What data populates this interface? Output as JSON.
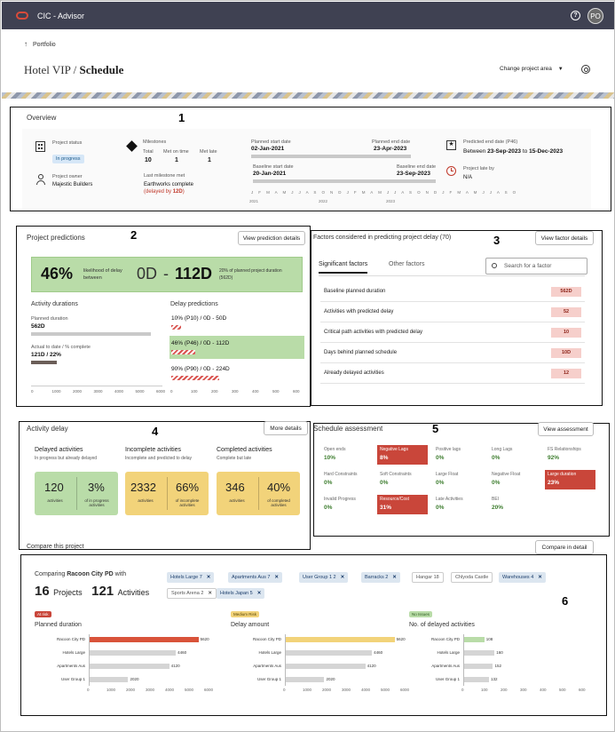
{
  "app": {
    "title": "CIC - Advisor",
    "help": "?",
    "avatar": "PO"
  },
  "breadcrumb": "Portfolio",
  "page": {
    "project": "Hotel VIP",
    "section": "Schedule",
    "change_area": "Change project area"
  },
  "markers": [
    "1",
    "2",
    "3",
    "4",
    "5",
    "6"
  ],
  "overview": {
    "title": "Overview",
    "project_status_label": "Project status",
    "project_status": "In progress",
    "owner_label": "Project owner",
    "owner": "Majestic Builders",
    "milestones_label": "Milestones",
    "ms_total_label": "Total",
    "ms_total": "10",
    "ms_ontime_label": "Met on time",
    "ms_ontime": "1",
    "ms_late_label": "Met late",
    "ms_late": "1",
    "last_ms_label": "Last milestone met",
    "last_ms": "Earthworks complete",
    "last_ms_delay_prefix": "(delayed by ",
    "last_ms_delay": "12D",
    "last_ms_delay_suffix": ")",
    "planned_start_label": "Planned start date",
    "planned_start": "02-Jan-2021",
    "planned_end_label": "Planned end date",
    "planned_end": "23-Apr-2023",
    "baseline_start_label": "Baseline start date",
    "baseline_start": "20-Jan-2021",
    "baseline_end_label": "Baseline end date",
    "baseline_end": "23-Sep-2023",
    "months": "J F M A M J J A S O N D J F M A M J J A S O N D J F M A M J J A S O",
    "years": [
      "2021",
      "2022",
      "2023"
    ],
    "predicted_end_label": "Predicted end date (P46)",
    "predicted_end_prefix": "Between",
    "predicted_end_from": "23-Sep-2023",
    "predicted_end_to_word": "to",
    "predicted_end_to": "15-Dec-2023",
    "late_by_label": "Project late by",
    "late_by": "N/A"
  },
  "predictions": {
    "title": "Project predictions",
    "details_button": "View prediction details",
    "likelihood": "46%",
    "likelihood_text": "likelihood of delay between",
    "range_low": "0D",
    "range_sep": "-",
    "range_high": "112D",
    "note": "20% of planned project duration (562D)",
    "activity_durations": "Activity durations",
    "planned_duration_label": "Planned duration",
    "planned_duration": "562D",
    "actual_label": "Actual to date / % complete",
    "actual": "121D / 22%",
    "delay_predictions": "Delay predictions",
    "p10": "10% (P10) / 0D - 50D",
    "p46": "46% (P46) / 0D - 112D",
    "p90": "90% (P90) / 0D - 224D",
    "axis": [
      "0",
      "1000",
      "2000",
      "3000",
      "4000",
      "5000",
      "6000"
    ],
    "axis2": [
      "0",
      "100",
      "200",
      "300",
      "400",
      "500",
      "600"
    ]
  },
  "factors": {
    "title": "Factors considered in predicting project delay (70)",
    "details_button": "View factor details",
    "tab_significant": "Significant factors",
    "tab_other": "Other factors",
    "search_placeholder": "Search for a factor",
    "rows": [
      {
        "label": "Baseline planned duration",
        "value": "562D"
      },
      {
        "label": "Activities with predicted delay",
        "value": "52"
      },
      {
        "label": "Critical path activities with predicted delay",
        "value": "10"
      },
      {
        "label": "Days behind planned schedule",
        "value": "10D"
      },
      {
        "label": "Already delayed activities",
        "value": "12"
      }
    ]
  },
  "activity_delay": {
    "title": "Activity delay",
    "more_button": "More details",
    "delayed_title": "Delayed activities",
    "delayed_sub": "In progress but already delayed",
    "incomplete_title": "Incomplete activities",
    "incomplete_sub": "Incomplete and predicted to delay",
    "completed_title": "Completed activities",
    "completed_sub": "Complete but late",
    "delayed_count": "120",
    "delayed_count_label": "activities",
    "delayed_pct": "3%",
    "delayed_pct_label": "of in progress activities",
    "incomplete_count": "2332",
    "incomplete_count_label": "activities",
    "incomplete_pct": "66%",
    "incomplete_pct_label": "of incomplete activities",
    "completed_count": "346",
    "completed_count_label": "activities",
    "completed_pct": "40%",
    "completed_pct_label": "of completed activities"
  },
  "schedule": {
    "title": "Schedule assessment",
    "button": "View assessment",
    "cells": [
      {
        "name": "Open ends",
        "value": "10%",
        "alert": false
      },
      {
        "name": "Negative Lags",
        "value": "8%",
        "alert": true
      },
      {
        "name": "Positive lags",
        "value": "0%",
        "alert": false
      },
      {
        "name": "Long Lags",
        "value": "0%",
        "alert": false
      },
      {
        "name": "FS Relationships",
        "value": "92%",
        "alert": false
      },
      {
        "name": "Hard Constraints",
        "value": "0%",
        "alert": false
      },
      {
        "name": "Soft Constraints",
        "value": "0%",
        "alert": false
      },
      {
        "name": "Large Float",
        "value": "0%",
        "alert": false
      },
      {
        "name": "Negative Float",
        "value": "0%",
        "alert": false
      },
      {
        "name": "Large duration",
        "value": "23%",
        "alert": true
      },
      {
        "name": "Invalid Progress",
        "value": "0%",
        "alert": false
      },
      {
        "name": "Resource/Cost",
        "value": "31%",
        "alert": true
      },
      {
        "name": "Late Activities",
        "value": "0%",
        "alert": false
      },
      {
        "name": "BEI",
        "value": "20%",
        "alert": false
      }
    ]
  },
  "compare": {
    "title": "Compare this project",
    "button": "Compare in detail",
    "comparing_prefix": "Comparing",
    "comparing_project": "Racoon City PD",
    "comparing_suffix": "with",
    "projects_count": "16",
    "projects_label": "Projects",
    "activities_count": "121",
    "activities_label": "Activities",
    "chips": [
      {
        "label": "Hotels Large",
        "n": "7",
        "active": true
      },
      {
        "label": "Apartments Aus",
        "n": "7",
        "active": true
      },
      {
        "label": "User Group 1",
        "n": "2",
        "active": true
      },
      {
        "label": "Barracks",
        "n": "2",
        "active": true
      },
      {
        "label": "Hangar",
        "n": "18",
        "active": false
      },
      {
        "label": "Chlyoda Castle",
        "n": "",
        "active": false
      },
      {
        "label": "Warehouses",
        "n": "4",
        "active": true
      },
      {
        "label": "Sports Arena",
        "n": "2",
        "active": false
      },
      {
        "label": "Hotels Japan",
        "n": "5",
        "active": true
      }
    ],
    "panels": [
      {
        "risk": "At risk",
        "risk_color": "#c9463a",
        "risk_text": "#ffffff",
        "title": "Planned duration",
        "bar_color": "#d9533a",
        "rows": [
          {
            "label": "Racoon City PD",
            "value": 5620
          },
          {
            "label": "Hotels Large",
            "value": 4460
          },
          {
            "label": "Apartments Aus",
            "value": 4120
          },
          {
            "label": "User Group 1",
            "value": 2020
          }
        ],
        "axis": [
          "0",
          "1000",
          "2000",
          "3000",
          "4000",
          "5000",
          "6000"
        ],
        "max": 6000
      },
      {
        "risk": "Medium Risk",
        "risk_color": "#f2d37a",
        "risk_text": "#5a4600",
        "title": "Delay amount",
        "bar_color": "#f2d37a",
        "rows": [
          {
            "label": "Racoon City PD",
            "value": 5620
          },
          {
            "label": "Hotels Large",
            "value": 4460
          },
          {
            "label": "Apartments Aus",
            "value": 4120
          },
          {
            "label": "User Group 1",
            "value": 2020
          }
        ],
        "axis": [
          "0",
          "1000",
          "2000",
          "3000",
          "4000",
          "5000",
          "6000"
        ],
        "max": 6000
      },
      {
        "risk": "No Issues",
        "risk_color": "#b9dca8",
        "risk_text": "#2d5a1e",
        "title": "No. of delayed activities",
        "bar_color": "#b9dca8",
        "rows": [
          {
            "label": "Racoon City PD",
            "value": 108
          },
          {
            "label": "Hotels Large",
            "value": 160
          },
          {
            "label": "Apartments Aus",
            "value": 152
          },
          {
            "label": "User Group 1",
            "value": 132
          }
        ],
        "axis": [
          "0",
          "100",
          "200",
          "300",
          "400",
          "500",
          "600"
        ],
        "max": 600
      }
    ]
  }
}
